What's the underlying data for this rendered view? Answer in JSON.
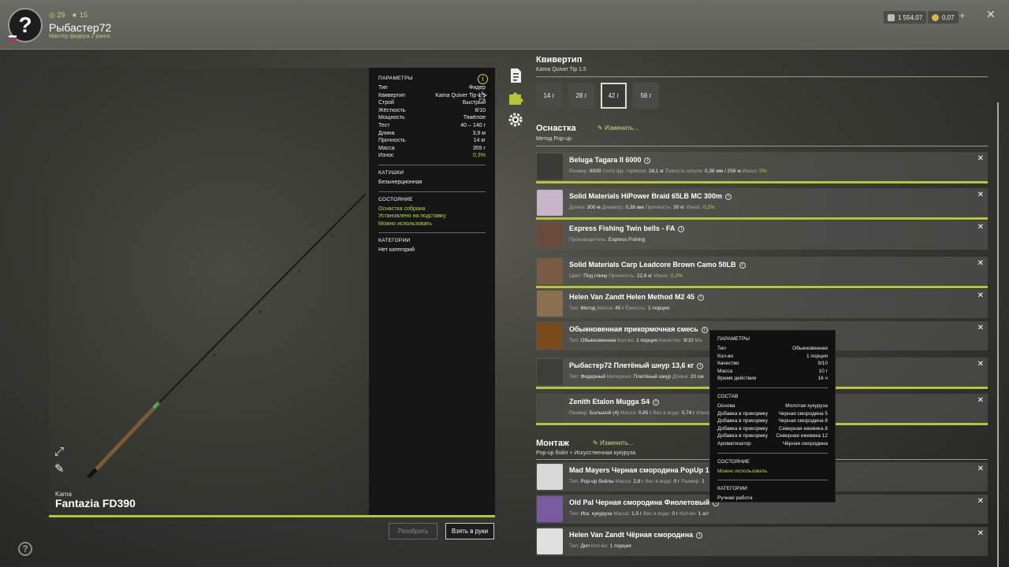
{
  "player": {
    "avatar": "?",
    "level": "29",
    "rank_level": "15",
    "name": "Рыбастер72",
    "rank": "Мастер фидера 2 ранга"
  },
  "currency": {
    "silver": "1 554,07",
    "gold": "0,07",
    "plus": "+"
  },
  "close": "✕",
  "rod": {
    "brand": "Kama",
    "name": "Fantazia FD390"
  },
  "params": {
    "title": "ПАРАМЕТРЫ",
    "rows": [
      {
        "k": "Тип",
        "v": "Фидер"
      },
      {
        "k": "Квивертип",
        "v": "Kama Quiver Tip 1.5"
      },
      {
        "k": "Строй",
        "v": "Быстрый"
      },
      {
        "k": "Жёсткость",
        "v": "8/10"
      },
      {
        "k": "Мощность",
        "v": "Тяжёлое"
      },
      {
        "k": "Тест",
        "v": "40 – 140 г"
      },
      {
        "k": "Длина",
        "v": "3,9 м"
      },
      {
        "k": "Прочность",
        "v": "14 кг"
      },
      {
        "k": "Масса",
        "v": "355 г"
      },
      {
        "k": "Износ",
        "v": "0,3%"
      }
    ],
    "reels_title": "КАТУШКИ",
    "reels_value": "Безынерционная",
    "state_title": "СОСТОЯНИЕ",
    "state_lines": [
      "Оснастка собрана",
      "Установлено на подставку",
      "Можно использовать"
    ],
    "cat_title": "КАТЕГОРИИ",
    "cat_value": "Нет категорий"
  },
  "buttons": {
    "disassemble": "Разобрать",
    "take": "Взять в руки"
  },
  "quiver": {
    "title": "Квивертип",
    "subtitle": "Kama Quiver Tip 1.5",
    "weights": [
      "14 г",
      "28 г",
      "42 г",
      "56 г"
    ],
    "selected": "42 г"
  },
  "tackle": {
    "title": "Оснастка",
    "edit": "Изменить...",
    "subtitle": "Метод Pop-up"
  },
  "items": [
    {
      "name": "Beluga Tagara II 6000",
      "details": [
        [
          "Размер:",
          "6000"
        ],
        [
          "Сила фр. тормоза:",
          "18,1 кг"
        ],
        [
          "Ёмкость шпули:",
          "0,38 мм / 256 м"
        ],
        [
          "Износ:",
          "0%"
        ]
      ]
    },
    {
      "name": "Solid Materials HiPower Braid 65LB MC 300m",
      "details": [
        [
          "Длина:",
          "300 м"
        ],
        [
          "Диаметр:",
          "0,38 мм"
        ],
        [
          "Прочность:",
          "30 кг"
        ],
        [
          "Износ:",
          "0,2%"
        ]
      ]
    },
    {
      "name": "Express Fishing Twin bells - FA",
      "details": [
        [
          "Производитель:",
          "Express Fishing"
        ]
      ]
    },
    {
      "name": "Solid Materials Carp Leadcore Brown Camo 50LB",
      "details": [
        [
          "Цвет:",
          "Под глину"
        ],
        [
          "Прочность:",
          "22,6 кг"
        ],
        [
          "Износ:",
          "0,2%"
        ]
      ]
    },
    {
      "name": "Helen Van Zandt Helen Method M2 45",
      "details": [
        [
          "Тип:",
          "Метод"
        ],
        [
          "Масса:",
          "45 г"
        ],
        [
          "Ёмкость:",
          "1 порция"
        ]
      ]
    },
    {
      "name": "Обыкновенная прикормочная смесь",
      "details": [
        [
          "Тип:",
          "Обыкновенная"
        ],
        [
          "Кол-во:",
          "1 порция"
        ],
        [
          "Качество:",
          "9/10"
        ],
        [
          "Ма",
          ""
        ]
      ]
    },
    {
      "name": "Рыбастер72 Плетёный шнур 13,6 кг",
      "details": [
        [
          "Тип:",
          "Фидерный"
        ],
        [
          "Материал:",
          "Плетёный шнур"
        ],
        [
          "Длина:",
          "20 см"
        ]
      ]
    },
    {
      "name": "Zenith Etalon Mugga S4",
      "details": [
        [
          "Размер:",
          "Большой (4)"
        ],
        [
          "Масса:",
          "0,85 г"
        ],
        [
          "Вес в воде:",
          "0,74 г"
        ],
        [
          "Износ:",
          ""
        ]
      ]
    }
  ],
  "mount": {
    "title": "Монтаж",
    "edit": "Изменить...",
    "subtitle": "Pop-up бойл + Искусственная кукуруза"
  },
  "mount_items": [
    {
      "name": "Mad Mayers Черная смородина PopUp 1",
      "details": [
        [
          "Тип:",
          "Pop-up бойлы"
        ],
        [
          "Масса:",
          "2,8 г"
        ],
        [
          "Вес в воде:",
          "0 г"
        ],
        [
          "Размер:",
          "1"
        ]
      ]
    },
    {
      "name": "Old Pal Черная смородина Фиолетовый",
      "details": [
        [
          "Тип:",
          "Иск. кукуруза"
        ],
        [
          "Масса:",
          "1,5 г"
        ],
        [
          "Вес в воде:",
          "0 г"
        ],
        [
          "Кол-во:",
          "1 шт"
        ]
      ]
    },
    {
      "name": "Helen Van Zandt Чёрная смородина",
      "details": [
        [
          "Тип:",
          "Дип"
        ],
        [
          "Кол-во:",
          "1 порция"
        ]
      ]
    }
  ],
  "tooltip": {
    "params_title": "ПАРАМЕТРЫ",
    "params": [
      {
        "k": "Тип",
        "v": "Обыкновенная"
      },
      {
        "k": "Кол-во",
        "v": "1 порция"
      },
      {
        "k": "Качество",
        "v": "9/10"
      },
      {
        "k": "Масса",
        "v": "10 г"
      },
      {
        "k": "Время действия",
        "v": "16 ч"
      }
    ],
    "comp_title": "СОСТАВ",
    "comp": [
      {
        "k": "Основа",
        "v": "Молотая кукуруза"
      },
      {
        "k": "Добавка в прикормку",
        "v": "Черная смородина 5"
      },
      {
        "k": "Добавка в прикормку",
        "v": "Черная смородина 8"
      },
      {
        "k": "Добавка в прикормку",
        "v": "Северная ежевика 8"
      },
      {
        "k": "Добавка в прикормку",
        "v": "Северная ежевика 12"
      },
      {
        "k": "Ароматизатор",
        "v": "Чёрная смородина"
      }
    ],
    "state_title": "СОСТОЯНИЕ",
    "state": "Можно использовать",
    "cat_title": "КАТЕГОРИИ",
    "cat": "Ручная работа"
  },
  "colors": {
    "accent": "#b8c53a",
    "ok": "#c2d44a"
  },
  "icons": [
    "question-icon",
    "silver-coin-icon",
    "gold-coin-icon",
    "info-icon",
    "star-icon",
    "notes-tab-icon",
    "puzzle-tab-icon",
    "gear-tab-icon",
    "fullscreen-icon",
    "brush-icon",
    "edit-icon",
    "close-icon"
  ]
}
